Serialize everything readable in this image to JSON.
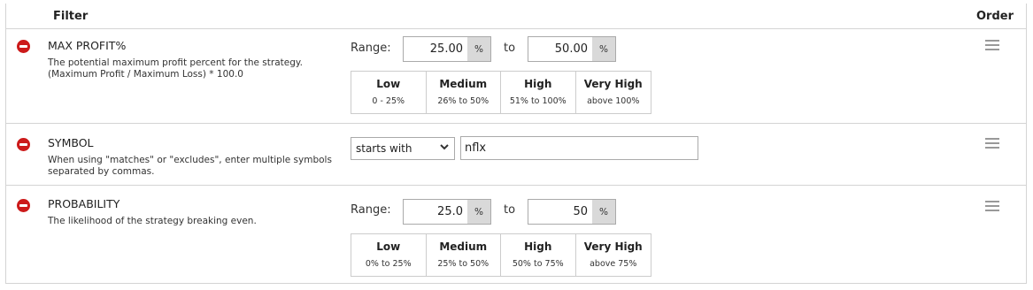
{
  "header": {
    "filter_label": "Filter",
    "order_label": "Order"
  },
  "filters": [
    {
      "name": "MAX PROFIT%",
      "description": "The potential maximum profit percent for the strategy. (Maximum Profit / Maximum Loss) * 100.0",
      "range_label": "Range:",
      "to_label": "to",
      "min_value": "25.00",
      "max_value": "50.00",
      "unit": "%",
      "presets": [
        {
          "title": "Low",
          "range": "0 - 25%"
        },
        {
          "title": "Medium",
          "range": "26% to 50%"
        },
        {
          "title": "High",
          "range": "51% to 100%"
        },
        {
          "title": "Very High",
          "range": "above 100%"
        }
      ]
    },
    {
      "name": "SYMBOL",
      "description": "When using \"matches\" or \"excludes\", enter multiple symbols separated by commas.",
      "operator": "starts with",
      "value": "nflx"
    },
    {
      "name": "PROBABILITY",
      "description": "The likelihood of the strategy breaking even.",
      "range_label": "Range:",
      "to_label": "to",
      "min_value": "25.0",
      "max_value": "50",
      "unit": "%",
      "presets": [
        {
          "title": "Low",
          "range": "0% to 25%"
        },
        {
          "title": "Medium",
          "range": "25% to 50%"
        },
        {
          "title": "High",
          "range": "50% to 75%"
        },
        {
          "title": "Very High",
          "range": "above 75%"
        }
      ]
    }
  ],
  "colors": {
    "remove_icon": "#cc1a1a",
    "unit_bg": "#d9d9d9",
    "border": "#d4d4d4"
  },
  "icons": {
    "remove": "remove-circle-icon",
    "drag": "drag-handle-icon",
    "dropdown": "chevron-down-icon"
  }
}
